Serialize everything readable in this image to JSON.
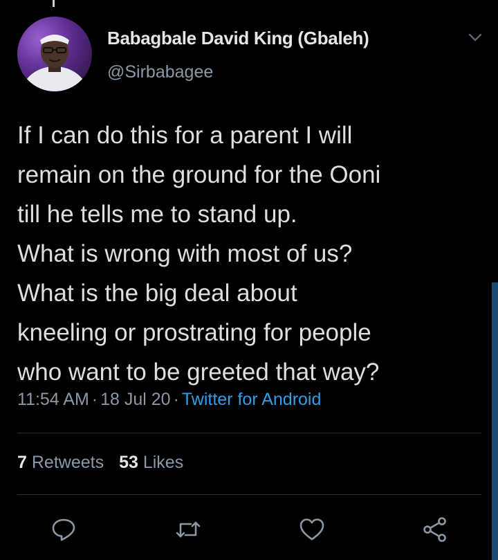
{
  "tweet": {
    "author": {
      "display_name": "Babagbale David King (Gbaleh)",
      "handle": "@Sirbabagee"
    },
    "text_lines": [
      "If I can do this for a parent I will",
      "remain on the ground for the Ooni",
      "till he tells me to stand up.",
      "What is wrong with most of us?",
      "What is the big deal about",
      "kneeling or prostrating for people",
      "who want to be greeted that way?"
    ],
    "time": "11:54 AM",
    "date": "18 Jul 20",
    "source": "Twitter for Android",
    "separator": "·",
    "stats": {
      "retweets_count": "7",
      "retweets_label": "Retweets",
      "likes_count": "53",
      "likes_label": "Likes"
    }
  },
  "icons": {
    "caret": "chevron-down-icon",
    "reply": "reply-icon",
    "retweet": "retweet-icon",
    "like": "heart-icon",
    "share": "share-icon"
  },
  "colors": {
    "background": "#000000",
    "text_primary": "#dedede",
    "text_secondary": "#8b98a5",
    "link": "#2f9fe8",
    "scrollbar": "#1b4a73"
  }
}
